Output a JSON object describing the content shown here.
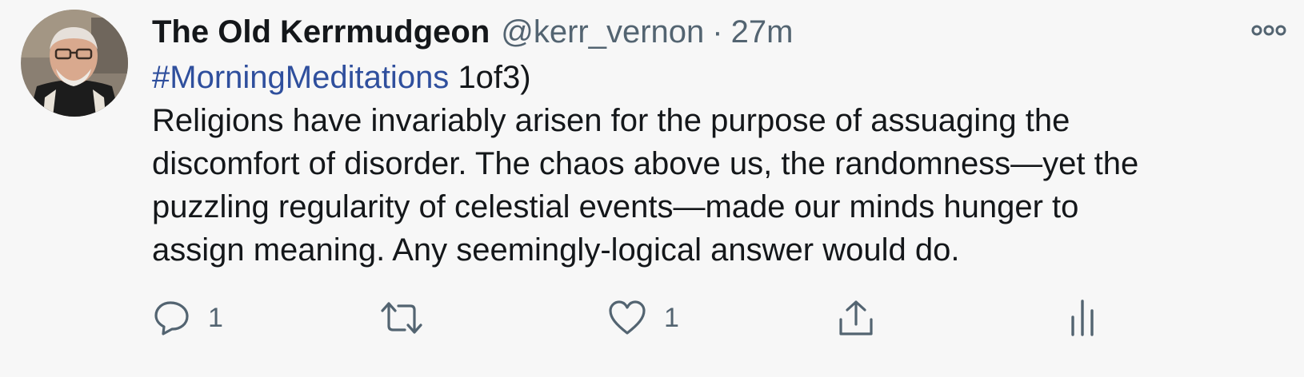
{
  "author": {
    "display_name": "The Old Kerrmudgeon",
    "handle": "@kerr_vernon",
    "separator": "·",
    "time": "27m"
  },
  "tweet": {
    "hashtag": "#MorningMeditations",
    "thread_marker": "1of3)",
    "lines": [
      "Religions have invariably arisen for the purpose of assuaging the",
      "discomfort of disorder. The chaos above us, the randomness—yet the",
      "puzzling regularity of celestial events—made our minds hunger to",
      "assign meaning. Any seemingly-logical answer would do."
    ]
  },
  "actions": {
    "reply": {
      "icon": "reply-bubble-icon",
      "count": "1"
    },
    "retweet": {
      "icon": "retweet-icon",
      "count": ""
    },
    "like": {
      "icon": "heart-icon",
      "count": "1"
    },
    "share": {
      "icon": "share-upload-icon"
    },
    "analytics": {
      "icon": "analytics-bars-icon"
    }
  },
  "colors": {
    "background": "#f7f7f7",
    "text": "#14171a",
    "secondary": "#536471",
    "hashtag": "#2f4f9d"
  }
}
